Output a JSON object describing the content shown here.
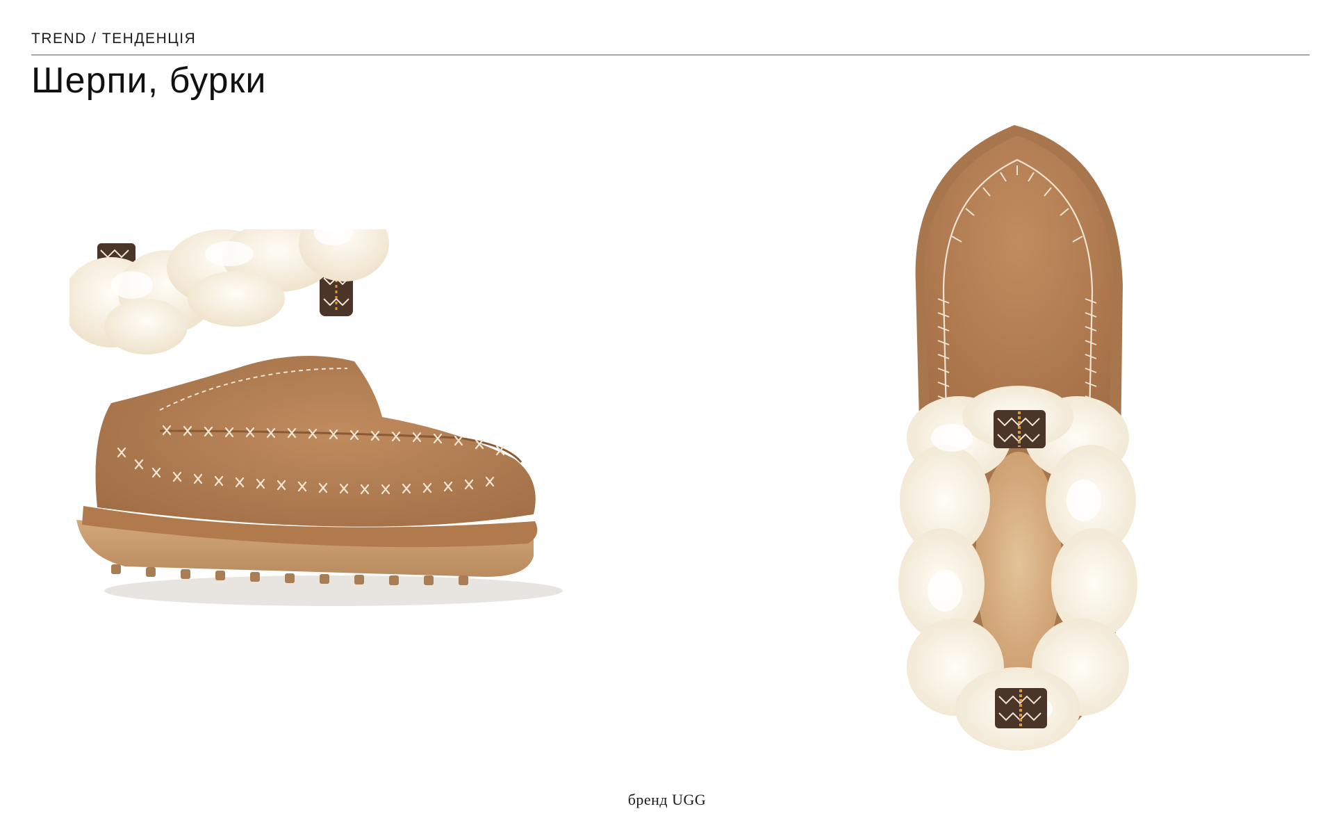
{
  "header": {
    "kicker": "TREND / ТЕНДЕНЦІЯ",
    "title": "Шерпи, бурки"
  },
  "images": [
    {
      "name": "slipper-side-view",
      "description_icon": "slipper-photo"
    },
    {
      "name": "slipper-top-view",
      "description_icon": "slipper-photo"
    }
  ],
  "caption": "бренд UGG",
  "colors": {
    "suede": "#b27f54",
    "suede_dark": "#9c6b43",
    "sole": "#c89a6c",
    "fur": "#fbf4e6",
    "stitch": "#efe4d2",
    "band_dark": "#4a3528",
    "rule": "#a6a6a6"
  }
}
